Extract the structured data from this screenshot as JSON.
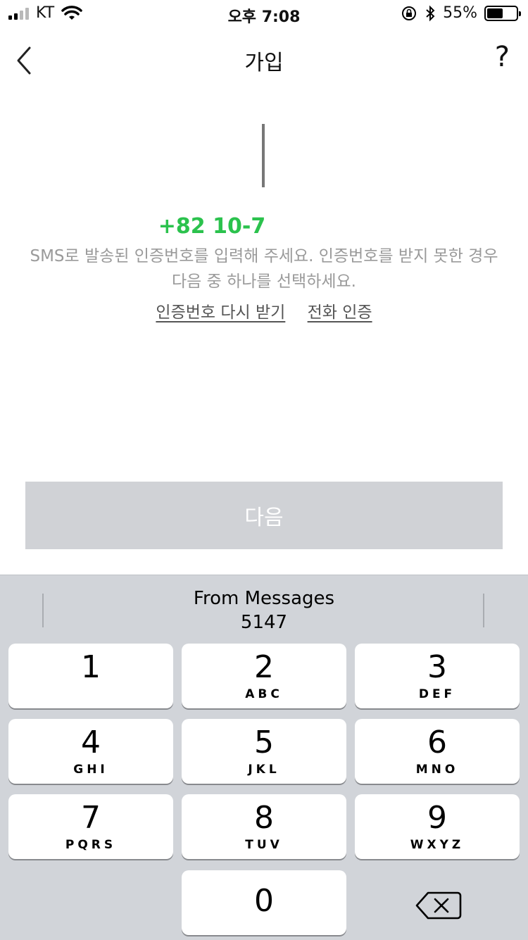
{
  "status_bar": {
    "carrier": "KT",
    "time": "오후 7:08",
    "battery_percent": "55%",
    "battery_level": 0.55
  },
  "nav": {
    "title": "가입",
    "help": "?"
  },
  "verification": {
    "phone": "+82 10-7",
    "description": "SMS로 발송된 인증번호를 입력해 주세요. 인증번호를 받지 못한 경우 다음 중 하나를 선택하세요.",
    "resend_link": "인증번호 다시 받기",
    "call_link": "전화 인증"
  },
  "next_button": "다음",
  "keyboard": {
    "suggestion_source": "From Messages",
    "suggestion_code": "5147",
    "keys": [
      {
        "num": "1",
        "letters": ""
      },
      {
        "num": "2",
        "letters": "ABC"
      },
      {
        "num": "3",
        "letters": "DEF"
      },
      {
        "num": "4",
        "letters": "GHI"
      },
      {
        "num": "5",
        "letters": "JKL"
      },
      {
        "num": "6",
        "letters": "MNO"
      },
      {
        "num": "7",
        "letters": "PQRS"
      },
      {
        "num": "8",
        "letters": "TUV"
      },
      {
        "num": "9",
        "letters": "WXYZ"
      },
      {
        "num": "0",
        "letters": ""
      }
    ]
  },
  "colors": {
    "accent_green": "#2bc24d",
    "button_disabled": "#d0d2d6",
    "keyboard_bg": "#d1d4d9"
  }
}
